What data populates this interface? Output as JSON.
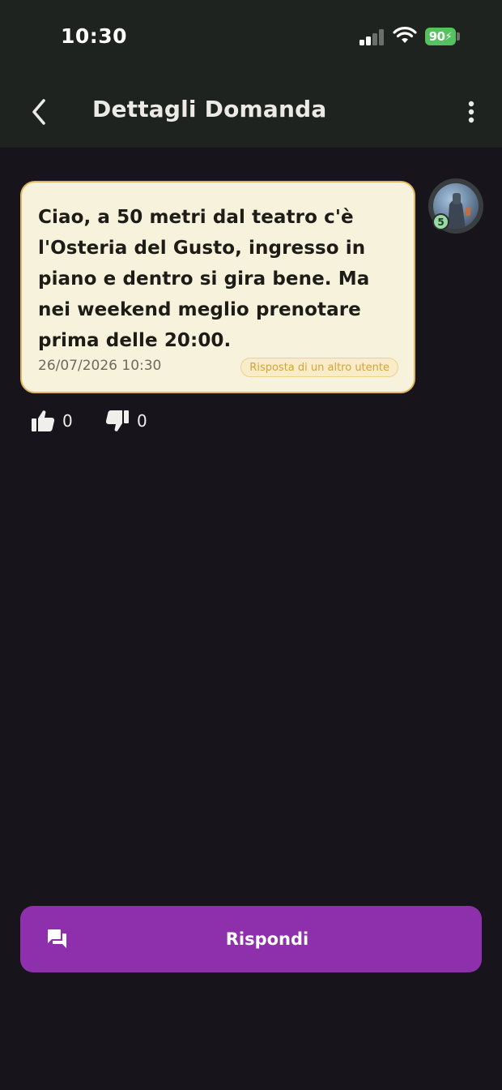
{
  "status_bar": {
    "time": "10:30",
    "battery": "90",
    "icons": [
      "cellular-signal-icon",
      "wifi-icon",
      "battery-charging-icon"
    ]
  },
  "app_bar": {
    "title": "Dettagli Domanda",
    "back_icon": "chevron-left-icon",
    "menu_icon": "more-vertical-icon"
  },
  "answer": {
    "text": "Ciao, a 50 metri dal teatro c'è l'Osteria del Gusto, ingresso in piano e dentro si gira bene. Ma nei weekend meglio prenotare prima delle 20:00.",
    "datetime": "26/07/2026 10:30",
    "badge": "Risposta di un altro utente",
    "author_level": "5",
    "likes": "0",
    "dislikes": "0"
  },
  "reply_button": {
    "label": "Rispondi",
    "icon": "chat-bubbles-icon"
  },
  "colors": {
    "background": "#17141b",
    "app_bar": "#1e231f",
    "bubble": "#f6f2dc",
    "bubble_border": "#e0b55a",
    "badge_text": "#d6a23c",
    "primary": "#8e2fac",
    "battery": "#56c15f"
  }
}
